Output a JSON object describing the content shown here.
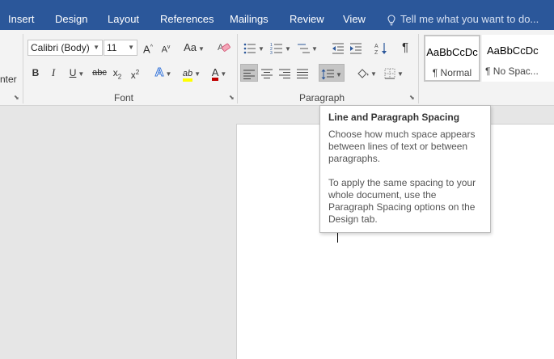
{
  "tabs": [
    "Insert",
    "Design",
    "Layout",
    "References",
    "Mailings",
    "Review",
    "View"
  ],
  "tell_me": "Tell me what you want to do...",
  "clipboard_partial_label": "nter",
  "font": {
    "name": "Calibri (Body)",
    "size": "11",
    "group_label": "Font",
    "change_case": "Aa",
    "grow": "A",
    "shrink": "A",
    "bold": "B",
    "italic": "I",
    "underline": "U",
    "strike": "abc",
    "subscript": "x",
    "subscript_mark": "2",
    "superscript": "x",
    "superscript_mark": "2",
    "text_effects": "A",
    "highlight": "ab",
    "font_color": "A"
  },
  "paragraph": {
    "group_label": "Paragraph",
    "show_marks": "¶"
  },
  "styles": [
    {
      "sample": "AaBbCcDc",
      "name": "¶ Normal"
    },
    {
      "sample": "AaBbCcDc",
      "name": "¶ No Spac..."
    }
  ],
  "tooltip": {
    "title": "Line and Paragraph Spacing",
    "para1": "Choose how much space appears between lines of text or between paragraphs.",
    "para2": "To apply the same spacing to your whole document, use the Paragraph Spacing options on the Design tab."
  },
  "colors": {
    "ribbon_tab_bar": "#2b579a",
    "highlight_color": "#ffff00",
    "font_color": "#c00000",
    "text_effects": "#3c78d8"
  }
}
